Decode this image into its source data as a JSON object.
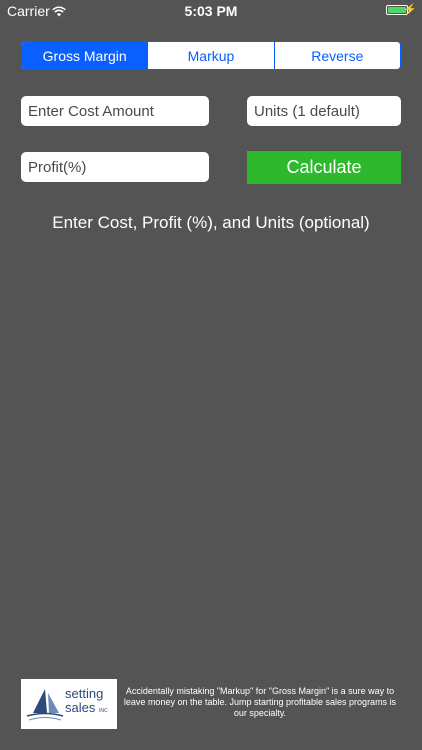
{
  "status_bar": {
    "carrier": "Carrier",
    "time": "5:03 PM",
    "wifi_icon": "wifi-icon",
    "battery_icon": "battery-icon",
    "battery_color": "#4cd964"
  },
  "tabs": [
    {
      "label": "Gross Margin",
      "active": true
    },
    {
      "label": "Markup",
      "active": false
    },
    {
      "label": "Reverse",
      "active": false
    }
  ],
  "inputs": {
    "cost_placeholder": "Enter Cost Amount",
    "units_placeholder": "Units (1 default)",
    "profit_placeholder": "Profit(%)"
  },
  "calculate_label": "Calculate",
  "instructions": "Enter Cost,  Profit (%), and Units (optional)",
  "footer": {
    "logo_line1": "setting",
    "logo_line2": "sales",
    "logo_suffix": "INC",
    "message": "Accidentally mistaking \"Markup\" for \"Gross Margin\" is a sure way to leave money on the table. Jump starting profitable sales programs is our specialty."
  },
  "colors": {
    "background": "#545454",
    "accent": "#0a60ff",
    "button": "#2eb82e"
  }
}
